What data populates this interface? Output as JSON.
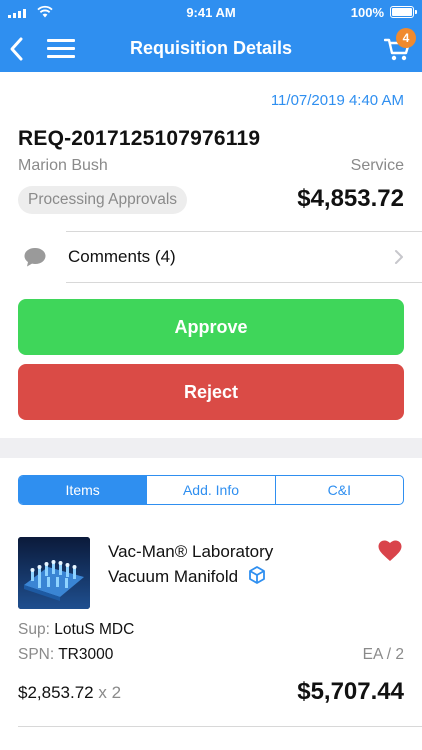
{
  "status_bar": {
    "time": "9:41 AM",
    "battery_percent": "100%",
    "battery_level": 1.0,
    "icons": [
      "signal-icon",
      "wifi-icon",
      "battery-icon"
    ]
  },
  "nav": {
    "title": "Requisition Details",
    "cart_badge": "4",
    "icons": [
      "back-chevron-icon",
      "hamburger-menu-icon",
      "cart-icon"
    ]
  },
  "requisition": {
    "date": "11/07/2019 4:40 AM",
    "id": "REQ-2017125107976119",
    "requester": "Marion Bush",
    "type": "Service",
    "status": "Processing Approvals",
    "total": "$4,853.72"
  },
  "comments": {
    "label": "Comments (4)",
    "icons": [
      "speech-bubble-icon",
      "chevron-right-icon"
    ]
  },
  "actions": {
    "approve_label": "Approve",
    "reject_label": "Reject",
    "approve_color": "#3fd65a",
    "reject_color": "#da4b46"
  },
  "tabs": [
    {
      "label": "Items",
      "active": true
    },
    {
      "label": "Add. Info",
      "active": false
    },
    {
      "label": "C&I",
      "active": false
    }
  ],
  "item": {
    "name": "Vac-Man® Laboratory Vacuum Manifold",
    "supplier_label": "Sup:",
    "supplier": "LotuS MDC",
    "spn_label": "SPN:",
    "spn": "TR3000",
    "uom": "EA / 2",
    "unit_price": "$2,853.72",
    "quantity": "x 2",
    "extended_price": "$5,707.44",
    "favorited": true,
    "icons": [
      "product-thumbnail",
      "cube-icon",
      "heart-icon"
    ]
  },
  "colors": {
    "brand_blue": "#2f8ff0",
    "badge_orange": "#f08a2e",
    "heart_red": "#d9434b"
  }
}
